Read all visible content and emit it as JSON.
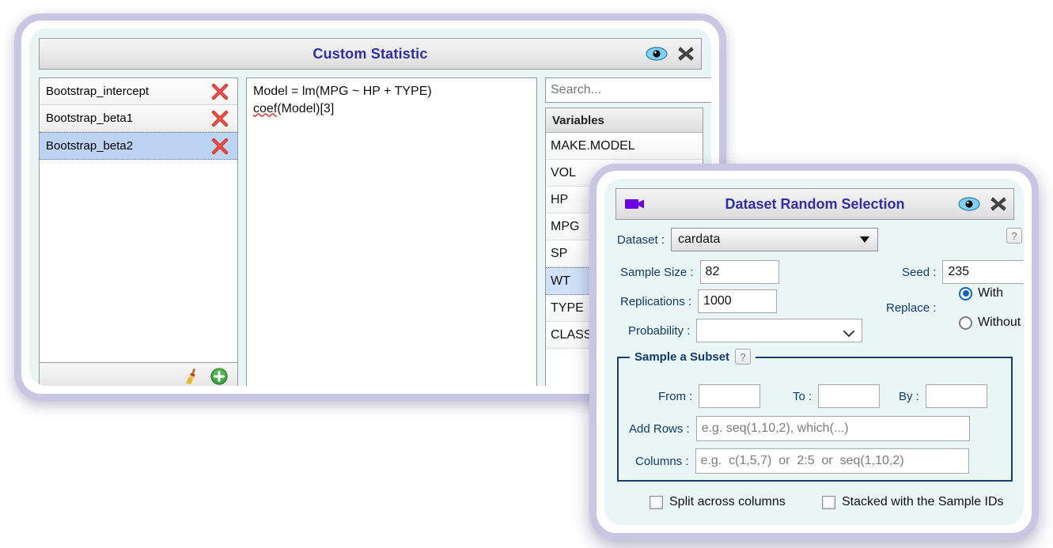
{
  "custom_statistic": {
    "title": "Custom Statistic",
    "titlebar_icons": [
      {
        "name": "eye-icon",
        "label": "Preview"
      },
      {
        "name": "close-icon",
        "label": "Close"
      }
    ],
    "stat_list": [
      {
        "label": "Bootstrap_intercept",
        "selected": false
      },
      {
        "label": "Bootstrap_beta1",
        "selected": false
      },
      {
        "label": "Bootstrap_beta2",
        "selected": true
      }
    ],
    "delete_icon_label": "Delete",
    "toolbar": {
      "clear_label": "Clear All",
      "add_label": "Add"
    },
    "code": {
      "line1": "Model = lm(MPG ~ HP + TYPE)",
      "line2_misspelled": "coef",
      "line2_rest": "(Model)[3]"
    },
    "search": {
      "placeholder": "Search...",
      "value": "",
      "clear_label": "✖"
    },
    "variables_header": "Variables",
    "variables": [
      {
        "name": "MAKE.MODEL",
        "selected": false
      },
      {
        "name": "VOL",
        "selected": false
      },
      {
        "name": "HP",
        "selected": false
      },
      {
        "name": "MPG",
        "selected": false
      },
      {
        "name": "SP",
        "selected": false
      },
      {
        "name": "WT",
        "selected": true
      },
      {
        "name": "TYPE",
        "selected": false
      },
      {
        "name": "CLASS",
        "selected": false
      }
    ]
  },
  "dataset_random_selection": {
    "title": "Dataset Random Selection",
    "camera_icon_color": "#6a00e0",
    "titlebar_icons": [
      {
        "name": "eye-icon",
        "label": "Preview"
      },
      {
        "name": "close-icon",
        "label": "Close"
      }
    ],
    "help_label": "?",
    "dataset": {
      "label": "Dataset :",
      "value": "cardata"
    },
    "sample_size": {
      "label": "Sample Size :",
      "value": "82"
    },
    "seed": {
      "label": "Seed :",
      "value": "235"
    },
    "replications": {
      "label": "Replications :",
      "value": "1000"
    },
    "probability": {
      "label": "Probability :",
      "value": ""
    },
    "replace": {
      "label": "Replace :",
      "options": [
        {
          "label": "With",
          "selected": true
        },
        {
          "label": "Without",
          "selected": false
        }
      ]
    },
    "subset": {
      "legend": "Sample a Subset",
      "help_label": "?",
      "from": {
        "label": "From :",
        "value": "",
        "placeholder": ""
      },
      "to": {
        "label": "To :",
        "value": "",
        "placeholder": ""
      },
      "by": {
        "label": "By :",
        "value": "",
        "placeholder": ""
      },
      "add_rows": {
        "label": "Add Rows :",
        "value": "",
        "placeholder": "e.g. seq(1,10,2), which(...)"
      },
      "columns": {
        "label": "Columns :",
        "value": "",
        "placeholder": "e.g.  c(1,5,7)  or  2:5  or  seq(1,10,2)"
      }
    },
    "checkboxes": [
      {
        "label": "Split across columns",
        "checked": false
      },
      {
        "label": "Stacked with the Sample IDs",
        "checked": false
      }
    ]
  },
  "colors": {
    "window_border": "#c9c6e4",
    "panel_bg": "#e9f5f4",
    "title_text": "#2f2fa6",
    "label_text": "#123a6b",
    "selection_blue": "#bdd3f2",
    "fieldset_border": "#1b3d6e",
    "radio_accent": "#0a62d0",
    "delete_red": "#d8281f",
    "add_green": "#3fa63f"
  }
}
